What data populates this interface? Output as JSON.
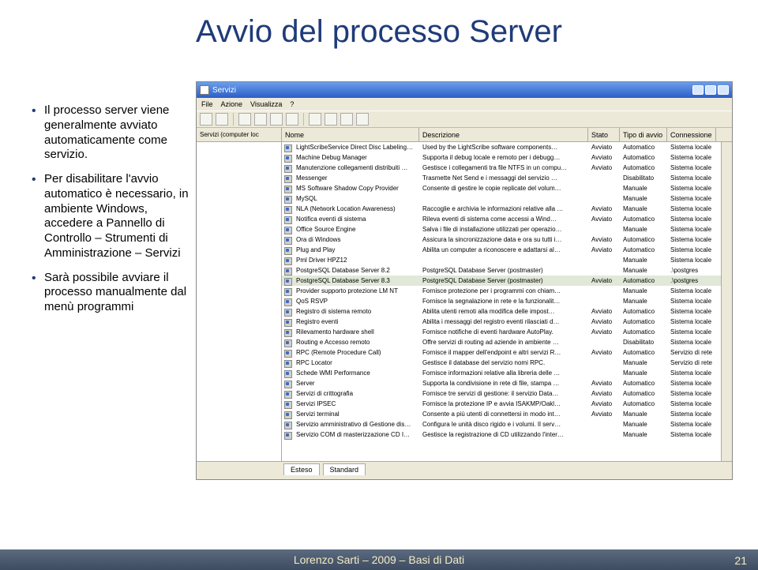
{
  "title": "Avvio del processo Server",
  "bullets": [
    "Il processo server viene generalmente avviato automaticamente come servizio.",
    "Per disabilitare l'avvio automatico è necessario, in ambiente Windows, accedere a Pannello di Controllo – Strumenti di Amministrazione – Servizi",
    "Sarà possibile avviare il processo manualmente dal menù programmi"
  ],
  "window": {
    "title": "Servizi",
    "menu": {
      "file": "File",
      "azione": "Azione",
      "visualizza": "Visualizza",
      "help": "?"
    },
    "leftpanel": "Servizi (computer loc",
    "columns": {
      "name": "Nome",
      "desc": "Descrizione",
      "stato": "Stato",
      "tipo": "Tipo di avvio",
      "conn": "Connessione"
    },
    "rows": [
      {
        "name": "LightScribeService Direct Disc Labeling…",
        "desc": "Used by the LightScribe software components…",
        "stato": "Avviato",
        "tipo": "Automatico",
        "conn": "Sistema locale"
      },
      {
        "name": "Machine Debug Manager",
        "desc": "Supporta il debug locale e remoto per i debugg…",
        "stato": "Avviato",
        "tipo": "Automatico",
        "conn": "Sistema locale"
      },
      {
        "name": "Manutenzione collegamenti distribuiti …",
        "desc": "Gestisce i collegamenti tra file NTFS in un compu…",
        "stato": "Avviato",
        "tipo": "Automatico",
        "conn": "Sistema locale"
      },
      {
        "name": "Messenger",
        "desc": "Trasmette Net Send e i messaggi del servizio …",
        "stato": "",
        "tipo": "Disabilitato",
        "conn": "Sistema locale"
      },
      {
        "name": "MS Software Shadow Copy Provider",
        "desc": "Consente di gestire le copie replicate del volum…",
        "stato": "",
        "tipo": "Manuale",
        "conn": "Sistema locale"
      },
      {
        "name": "MySQL",
        "desc": "",
        "stato": "",
        "tipo": "Manuale",
        "conn": "Sistema locale"
      },
      {
        "name": "NLA (Network Location Awareness)",
        "desc": "Raccoglie e archivia le informazioni relative alla …",
        "stato": "Avviato",
        "tipo": "Manuale",
        "conn": "Sistema locale"
      },
      {
        "name": "Notifica eventi di sistema",
        "desc": "Rileva eventi di sistema come accessi a Wind…",
        "stato": "Avviato",
        "tipo": "Automatico",
        "conn": "Sistema locale"
      },
      {
        "name": "Office Source Engine",
        "desc": "Salva i file di installazione utilizzati per operazio…",
        "stato": "",
        "tipo": "Manuale",
        "conn": "Sistema locale"
      },
      {
        "name": "Ora di Windows",
        "desc": "Assicura la sincronizzazione data e ora su tutti i…",
        "stato": "Avviato",
        "tipo": "Automatico",
        "conn": "Sistema locale"
      },
      {
        "name": "Plug and Play",
        "desc": "Abilita un computer a riconoscere e adattarsi al…",
        "stato": "Avviato",
        "tipo": "Automatico",
        "conn": "Sistema locale"
      },
      {
        "name": "Pml Driver HPZ12",
        "desc": "",
        "stato": "",
        "tipo": "Manuale",
        "conn": "Sistema locale"
      },
      {
        "name": "PostgreSQL Database Server 8.2",
        "desc": "PostgreSQL Database Server (postmaster)",
        "stato": "",
        "tipo": "Manuale",
        "conn": ".\\postgres"
      },
      {
        "name": "PostgreSQL Database Server 8.3",
        "desc": "PostgreSQL Database Server (postmaster)",
        "stato": "Avviato",
        "tipo": "Automatico",
        "conn": ".\\postgres",
        "selected": true
      },
      {
        "name": "Provider supporto protezione LM NT",
        "desc": "Fornisce protezione per i programmi con chiam…",
        "stato": "",
        "tipo": "Manuale",
        "conn": "Sistema locale"
      },
      {
        "name": "QoS RSVP",
        "desc": "Fornisce la segnalazione in rete e la funzionalit…",
        "stato": "",
        "tipo": "Manuale",
        "conn": "Sistema locale"
      },
      {
        "name": "Registro di sistema remoto",
        "desc": "Abilita utenti remoti alla modifica delle impost…",
        "stato": "Avviato",
        "tipo": "Automatico",
        "conn": "Sistema locale"
      },
      {
        "name": "Registro eventi",
        "desc": "Abilita i messaggi del registro eventi rilasciati d…",
        "stato": "Avviato",
        "tipo": "Automatico",
        "conn": "Sistema locale"
      },
      {
        "name": "Rilevamento hardware shell",
        "desc": "Fornisce notifiche di eventi hardware AutoPlay.",
        "stato": "Avviato",
        "tipo": "Automatico",
        "conn": "Sistema locale"
      },
      {
        "name": "Routing e Accesso remoto",
        "desc": "Offre servizi di routing ad aziende in ambiente …",
        "stato": "",
        "tipo": "Disabilitato",
        "conn": "Sistema locale"
      },
      {
        "name": "RPC (Remote Procedure Call)",
        "desc": "Fornisce il mapper dell'endpoint e altri servizi R…",
        "stato": "Avviato",
        "tipo": "Automatico",
        "conn": "Servizio di rete"
      },
      {
        "name": "RPC Locator",
        "desc": "Gestisce il database del servizio nomi RPC.",
        "stato": "",
        "tipo": "Manuale",
        "conn": "Servizio di rete"
      },
      {
        "name": "Schede WMI Performance",
        "desc": "Fornisce informazioni relative alla libreria delle …",
        "stato": "",
        "tipo": "Manuale",
        "conn": "Sistema locale"
      },
      {
        "name": "Server",
        "desc": "Supporta la condivisione in rete di file, stampa …",
        "stato": "Avviato",
        "tipo": "Automatico",
        "conn": "Sistema locale"
      },
      {
        "name": "Servizi di crittografia",
        "desc": "Fornisce tre servizi di gestione: il servizio Data…",
        "stato": "Avviato",
        "tipo": "Automatico",
        "conn": "Sistema locale"
      },
      {
        "name": "Servizi IPSEC",
        "desc": "Fornisce la protezione IP e avvia ISAKMP/Oakl…",
        "stato": "Avviato",
        "tipo": "Automatico",
        "conn": "Sistema locale"
      },
      {
        "name": "Servizi terminal",
        "desc": "Consente a più utenti di connettersi in modo int…",
        "stato": "Avviato",
        "tipo": "Manuale",
        "conn": "Sistema locale"
      },
      {
        "name": "Servizio amministrativo di Gestione dis…",
        "desc": "Configura le unità disco rigido e i volumi. Il serv…",
        "stato": "",
        "tipo": "Manuale",
        "conn": "Sistema locale"
      },
      {
        "name": "Servizio COM di masterizzazione CD I…",
        "desc": "Gestisce la registrazione di CD utilizzando l'inter…",
        "stato": "",
        "tipo": "Manuale",
        "conn": "Sistema locale"
      }
    ],
    "tabs": {
      "esteso": "Esteso",
      "standard": "Standard"
    }
  },
  "footer": "Lorenzo Sarti – 2009 – Basi di Dati",
  "pagenum": "21"
}
